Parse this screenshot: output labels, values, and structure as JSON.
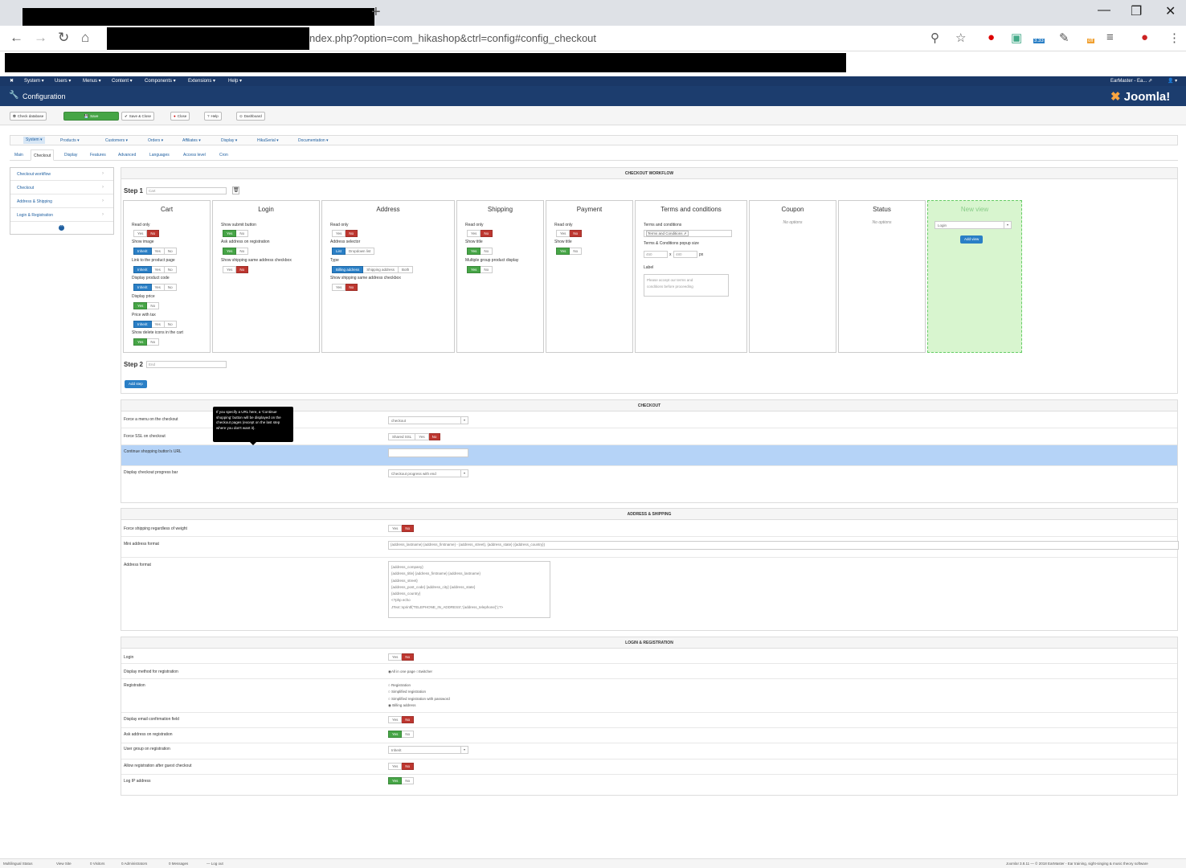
{
  "browser": {
    "url_visible": "ndex.php?option=com_hikashop&ctrl=config#config_checkout",
    "ext_badge": "3.33",
    "ext_badge2": "off"
  },
  "joomla": {
    "topmenu": [
      "System ▾",
      "Users ▾",
      "Menus ▾",
      "Content ▾",
      "Components ▾",
      "Extensions ▾",
      "Help ▾"
    ],
    "site_name": "EarMaster - Ea... ⇗",
    "user_icon": "👤 ▾",
    "page_title": "Configuration",
    "logo": "Joomla!"
  },
  "toolbar": {
    "check_database": "Check database",
    "save": "Save",
    "save_close": "Save & Close",
    "close": "Close",
    "help": "Help",
    "dashboard": "Dashboard"
  },
  "hikamenu": [
    "System ▾",
    "Products ▾",
    "Customers ▾",
    "Orders ▾",
    "Affiliates ▾",
    "Display ▾",
    "HikaSerial ▾",
    "Documentation ▾"
  ],
  "tabs": [
    "Main",
    "Checkout",
    "Display",
    "Features",
    "Advanced",
    "Languages",
    "Access level",
    "Cron"
  ],
  "side": [
    "Checkout workflow",
    "Checkout",
    "Address & Shipping",
    "Login & Registration"
  ],
  "workflow": {
    "heading": "CHECKOUT WORKFLOW",
    "step1_label": "Step 1",
    "step1_value": "Cart",
    "step2_label": "Step 2",
    "step2_value": "End",
    "add_step": "Add step",
    "cart": {
      "title": "Cart",
      "read_only": "Read only",
      "show_image": "Show image",
      "link_product": "Link to the product page",
      "display_code": "Display product code",
      "display_price": "Display price",
      "price_tax": "Price with tax",
      "show_delete": "Show delete icons in the cart"
    },
    "login": {
      "title": "Login",
      "show_submit": "Show submit button",
      "ask_address": "Ask address on registration",
      "show_shipping_same": "Show shipping same address checkbox"
    },
    "address": {
      "title": "Address",
      "read_only": "Read only",
      "address_selector": "Address selector",
      "type": "Type",
      "show_shipping_same": "Show shipping same address checkbox",
      "list": "List",
      "dropdown": "Dropdown list",
      "billing": "Billing address",
      "shipping": "Shipping address",
      "both": "Both"
    },
    "shipping": {
      "title": "Shipping",
      "read_only": "Read only",
      "show_title": "Show title",
      "multiple_group": "Multiple group product display"
    },
    "payment": {
      "title": "Payment",
      "read_only": "Read only",
      "show_title": "Show title"
    },
    "terms": {
      "title": "Terms and conditions",
      "terms_label": "Terms and conditions",
      "terms_value": "Terms and Conditions ⇗",
      "popup_size": "Terms & Conditions popup size",
      "width": "450",
      "x": "x",
      "height": "480",
      "px": "px",
      "label": "Label",
      "label_placeholder": "Please accept our terms and\nconditions before proceeding"
    },
    "coupon": {
      "title": "Coupon",
      "no_options": "No options"
    },
    "status": {
      "title": "Status",
      "no_options": "No options"
    },
    "newview": {
      "title": "New view",
      "select": "Login",
      "add_view": "Add view"
    },
    "yes": "Yes",
    "no": "No",
    "inherit": "Inherit"
  },
  "checkout": {
    "heading": "CHECKOUT",
    "force_menu": "Force a menu on the checkout",
    "force_menu_value": "checkout",
    "force_ssl": "Force SSL on checkout",
    "shared_ssl": "Shared SSL",
    "continue_url": "Continue shopping button's URL",
    "progress_bar": "Display checkout progress bar",
    "progress_value": "Checkout progress with end",
    "tooltip": "If you specify a URL here, a 'Continue shopping' button will be displayed on the checkout pages (except on the last step where you don't want it)."
  },
  "address_shipping": {
    "heading": "ADDRESS & SHIPPING",
    "force_shipping": "Force shipping regardless of weight",
    "mini_format": "Mini address format",
    "mini_value": "{address_lastname} {address_firstname} - {address_street}, {address_state} ({address_country})",
    "address_format": "Address format",
    "address_value": "{address_company}\n{address_title} {address_firstname} {address_lastname}\n{address_street}\n{address_post_code} {address_city} {address_state}\n{address_country}\n<?php echo\nJText::sprintf('TELEPHONE_IN_ADDRESS','{address_telephone}');?>"
  },
  "login_registration": {
    "heading": "LOGIN & REGISTRATION",
    "login": "Login",
    "display_method": "Display method for registration",
    "method_all": "All in one page",
    "method_switcher": "Switcher",
    "registration": "Registration",
    "reg_options": [
      "Registration",
      "Simplified registration",
      "Simplified registration with password",
      "Billing address"
    ],
    "email_confirm": "Display email confirmation field",
    "ask_address": "Ask address on registration",
    "user_group": "User group on registration",
    "user_group_value": "Inherit",
    "allow_after_guest": "Allow registration after guest checkout",
    "log_ip": "Log IP address"
  },
  "statusbar": {
    "items": [
      "Multilingual Status",
      "View Site",
      "0 Visitors",
      "0 Administrators",
      "0 Messages",
      "— Log out"
    ],
    "right": "Joomla! 3.8.11 — © 2018 EarMaster - Ear training, sight-singing & music theory software"
  },
  "colors": {
    "joomla_blue": "#1c3d6e",
    "no_red": "#bd362f",
    "yes_green": "#46a546",
    "highlight": "#b5d3f7"
  }
}
